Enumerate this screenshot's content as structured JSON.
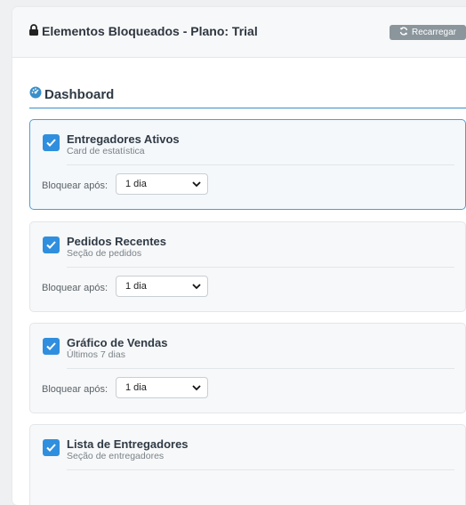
{
  "header": {
    "title": "Elementos Bloqueados - Plano: Trial",
    "reload_label": "Recarregar"
  },
  "section": {
    "title": "Dashboard"
  },
  "lock_label": "Bloquear após:",
  "colors": {
    "accent": "#2f8fde",
    "section_rule": "#3a8fc9",
    "reload_button": "#8b969c"
  },
  "items": [
    {
      "title": "Entregadores Ativos",
      "subtitle": "Card de estatística",
      "checked": true,
      "select_value": "1 dia"
    },
    {
      "title": "Pedidos Recentes",
      "subtitle": "Seção de pedidos",
      "checked": true,
      "select_value": "1 dia"
    },
    {
      "title": "Gráfico de Vendas",
      "subtitle": "Últimos 7 dias",
      "checked": true,
      "select_value": "1 dia"
    },
    {
      "title": "Lista de Entregadores",
      "subtitle": "Seção de entregadores",
      "checked": true
    }
  ]
}
